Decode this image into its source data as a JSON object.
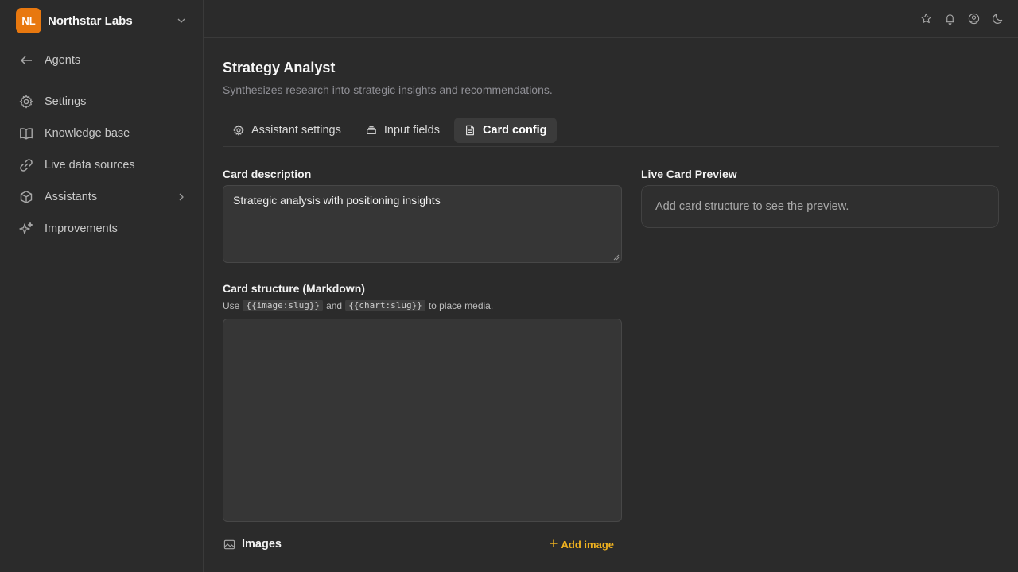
{
  "org": {
    "initials": "NL",
    "name": "Northstar Labs",
    "logo_color": "#e8780f"
  },
  "sidebar": {
    "back": {
      "label": "Agents",
      "icon": "arrow-left-icon"
    },
    "items": [
      {
        "label": "Settings",
        "icon": "gear-icon"
      },
      {
        "label": "Knowledge base",
        "icon": "book-icon"
      },
      {
        "label": "Live data sources",
        "icon": "link-icon"
      },
      {
        "label": "Assistants",
        "icon": "cube-icon",
        "has_submenu": true
      },
      {
        "label": "Improvements",
        "icon": "sparkles-icon"
      }
    ]
  },
  "topbar": {
    "icons": [
      "star-icon",
      "bell-icon",
      "user-circle-icon",
      "moon-icon"
    ]
  },
  "page": {
    "title": "Strategy Analyst",
    "subtitle": "Synthesizes research into strategic insights and recommendations."
  },
  "tabs": [
    {
      "label": "Assistant settings",
      "icon": "gear-icon",
      "active": false
    },
    {
      "label": "Input fields",
      "icon": "stack-icon",
      "active": false
    },
    {
      "label": "Card config",
      "icon": "document-icon",
      "active": true
    }
  ],
  "card_description": {
    "label": "Card description",
    "value": "Strategic analysis with positioning insights"
  },
  "card_structure": {
    "label": "Card structure (Markdown)",
    "hint_prefix": "Use",
    "hint_code1": "{{image:slug}}",
    "hint_mid": "and",
    "hint_code2": "{{chart:slug}}",
    "hint_suffix": "to place media.",
    "value": ""
  },
  "preview": {
    "label": "Live Card Preview",
    "empty_text": "Add card structure to see the preview."
  },
  "images": {
    "title": "Images",
    "add_label": "Add image",
    "accent": "#f0b21f"
  }
}
